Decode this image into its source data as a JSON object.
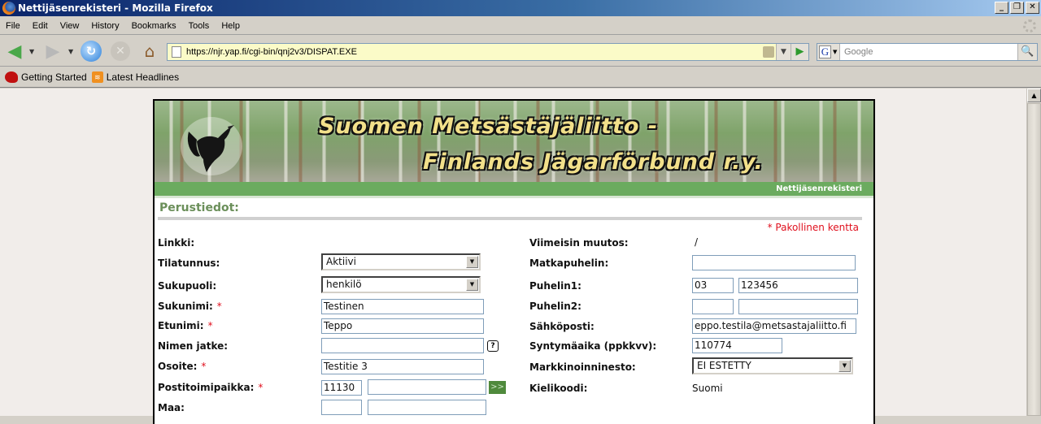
{
  "window": {
    "title": "Nettijäsenrekisteri - Mozilla Firefox",
    "controls": {
      "minimize": "_",
      "restore": "❐",
      "close": "✕"
    }
  },
  "menu": [
    "File",
    "Edit",
    "View",
    "History",
    "Bookmarks",
    "Tools",
    "Help"
  ],
  "nav": {
    "url": "https://njr.yap.fi/cgi-bin/qnj2v3/DISPAT.EXE",
    "search_placeholder": "Google",
    "search_engine_glyph": "G",
    "icons": {
      "back": "◀",
      "forward": "▶",
      "reload": "↻",
      "stop": "✕",
      "home": "⌂",
      "go": "▶",
      "search": "🔍",
      "dropdown": "▼"
    }
  },
  "bookmarks": [
    {
      "label": "Getting Started",
      "icon": "getting-started-icon"
    },
    {
      "label": "Latest Headlines",
      "icon": "rss-icon"
    }
  ],
  "banner": {
    "line1": "Suomen Metsästäjäliitto -",
    "line2": "Finlands Jägarförbund r.y.",
    "subtitle": "Nettijäsenrekisteri"
  },
  "form": {
    "section_title": "Perustiedot:",
    "required_note": "* Pakollinen kentta",
    "required_mark": "*",
    "left": {
      "linkki": {
        "label": "Linkki:"
      },
      "tilatunnus": {
        "label": "Tilatunnus:",
        "value": "Aktiivi"
      },
      "sukupuoli": {
        "label": "Sukupuoli:",
        "value": "henkilö"
      },
      "sukunimi": {
        "label": "Sukunimi:",
        "value": "Testinen"
      },
      "etunimi": {
        "label": "Etunimi:",
        "value": "Teppo"
      },
      "nimen_jatke": {
        "label": "Nimen jatke:",
        "value": "",
        "help": "?"
      },
      "osoite": {
        "label": "Osoite:",
        "value": "Testitie 3"
      },
      "postitoimipaikka": {
        "label": "Postitoimipaikka:",
        "postal_code": "11130",
        "city": "",
        "button": ">>"
      },
      "maa": {
        "label": "Maa:",
        "code": "",
        "name": ""
      }
    },
    "right": {
      "viimeisin_muutos": {
        "label": "Viimeisin muutos:",
        "value": "/"
      },
      "matkapuhelin": {
        "label": "Matkapuhelin:",
        "value": ""
      },
      "puhelin1": {
        "label": "Puhelin1:",
        "area": "03",
        "number": "123456"
      },
      "puhelin2": {
        "label": "Puhelin2:",
        "area": "",
        "number": ""
      },
      "sahkoposti": {
        "label": "Sähköposti:",
        "value": "eppo.testila@metsastajaliitto.fi"
      },
      "syntymaaika": {
        "label": "Syntymäaika (ppkkvv):",
        "value": "110774"
      },
      "markkinointi": {
        "label": "Markkinoinninesto:",
        "value": "EI ESTETTY"
      },
      "kielikoodi": {
        "label": "Kielikoodi:",
        "value": "Suomi"
      }
    }
  }
}
